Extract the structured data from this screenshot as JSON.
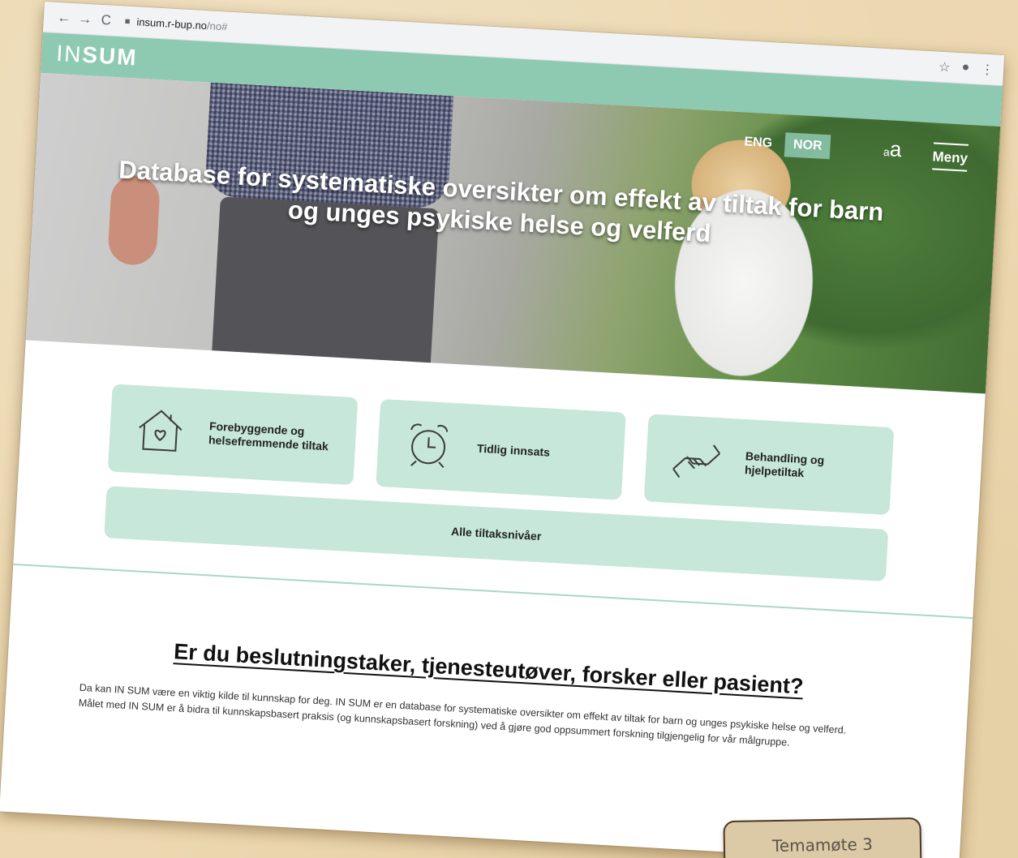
{
  "browser": {
    "back_icon": "←",
    "forward_icon": "→",
    "reload_icon": "C",
    "url_host": "insum.r-bup.no",
    "url_path": "/no#",
    "star_icon": "☆",
    "account_icon": "●",
    "more_icon": "⋮"
  },
  "site": {
    "logo_light": "IN",
    "logo_bold": "SUM",
    "brand_color": "#8ec9b2"
  },
  "hero": {
    "lang_eng": "ENG",
    "lang_nor": "NOR",
    "font_small": "a",
    "font_big": "a",
    "menu_label": "Meny",
    "title": "Database for systematiske oversikter om effekt av tiltak for barn og unges psykiske helse og velferd"
  },
  "categories": [
    {
      "label": "Forebyggende og helsefremmende tiltak",
      "icon": "house-heart-icon"
    },
    {
      "label": "Tidlig innsats",
      "icon": "alarm-clock-icon"
    },
    {
      "label": "Behandling og hjelpetiltak",
      "icon": "helping-hands-icon"
    }
  ],
  "all_levels_label": "Alle tiltaksnivåer",
  "info": {
    "title": "Er du beslutningstaker, tjenesteutøver, forsker eller pasient?",
    "line1": "Da kan IN SUM være en viktig kilde til kunnskap for deg. IN SUM er en database for systematiske oversikter om effekt av tiltak for barn og unges psykiske helse og velferd.",
    "line2": "Målet med IN SUM er å bidra til kunnskapsbasert praksis (og kunnskapsbasert forskning) ved å gjøre god oppsummert forskning tilgjengelig for vår målgruppe."
  },
  "note": {
    "text": "Temamøte 3"
  }
}
